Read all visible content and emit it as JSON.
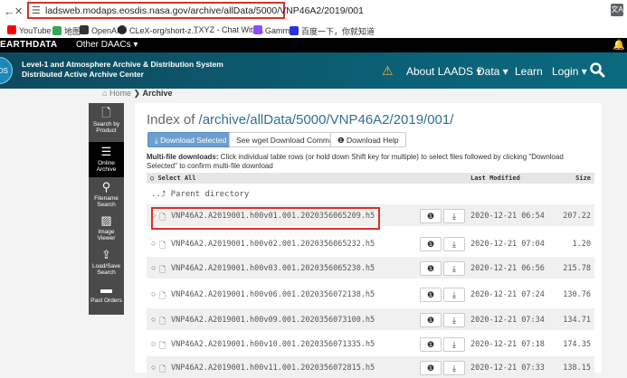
{
  "browser": {
    "back": "←",
    "close": "✕",
    "url": "ladsweb.modaps.eosdis.nasa.gov/archive/allData/5000/VNP46A2/2019/001",
    "translate_icon": "translate-icon"
  },
  "bookmarks": [
    {
      "label": "YouTube",
      "color": "#ff0000"
    },
    {
      "label": "地图",
      "color": "#34a853"
    },
    {
      "label": "OpenAI",
      "color": "#333333"
    },
    {
      "label": "CLeX-org/short-z...",
      "color": "#24292e"
    },
    {
      "label": "TXYZ - Chat With...",
      "color": "#ffffff"
    },
    {
      "label": "Gamma",
      "color": "#8a4dff"
    },
    {
      "label": "百度一下，你就知道",
      "color": "#2932e1"
    }
  ],
  "earthdata": {
    "logo": "EARTHDATA",
    "daacs": "Other DAACs ▾"
  },
  "header": {
    "logo_text": "ADS",
    "title_line1": "Level-1 and Atmosphere Archive & Distribution System",
    "title_line2": "Distributed Active Archive Center",
    "menu": {
      "about": "About LAADS ▾",
      "data": "Data ▾",
      "learn": "Learn",
      "login": "Login ▾"
    }
  },
  "breadcrumb": {
    "home": "Home",
    "current": "Archive"
  },
  "sidebar": [
    {
      "label": "Search by Product",
      "icon": "file-icon",
      "glyph": "🗋",
      "active": false
    },
    {
      "label": "Online Archive",
      "icon": "list-icon",
      "glyph": "☰",
      "active": true
    },
    {
      "label": "Filename Search",
      "icon": "search-icon",
      "glyph": "🔍",
      "active": false
    },
    {
      "label": "Image Viewer",
      "icon": "image-icon",
      "glyph": "▨",
      "active": false
    },
    {
      "label": "Load/Save Search",
      "icon": "upload-icon",
      "glyph": "⇪",
      "active": false
    },
    {
      "label": "Past Orders",
      "icon": "folder-icon",
      "glyph": "▬",
      "active": false
    }
  ],
  "main": {
    "index_prefix": "Index of ",
    "index_path": "/archive/allData/5000/VNP46A2/2019/001/",
    "buttons": {
      "download_selected": "Download Selected",
      "wget": "See wget Download Command",
      "help": "Download Help"
    },
    "multifile_bold": "Multi-file downloads:",
    "multifile_text": " Click individual table rows (or hold down Shift key for multiple) to select files followed by clicking \"Download Selected\" to confirm multi-file download",
    "table_header": {
      "select_all": "Select All",
      "last_modified": "Last Modified",
      "size": "Size"
    },
    "parent": "Parent directory",
    "files": [
      {
        "name": "VNP46A2.A2019001.h00v01.001.2020356065209.h5",
        "date": "2020-12-21 06:54",
        "size": "207.22"
      },
      {
        "name": "VNP46A2.A2019001.h00v02.001.2020356065232.h5",
        "date": "2020-12-21 07:04",
        "size": "1.20"
      },
      {
        "name": "VNP46A2.A2019001.h00v03.001.2020356065230.h5",
        "date": "2020-12-21 06:56",
        "size": "215.78"
      },
      {
        "name": "VNP46A2.A2019001.h00v06.001.2020356072138.h5",
        "date": "2020-12-21 07:24",
        "size": "130.76"
      },
      {
        "name": "VNP46A2.A2019001.h00v09.001.2020356073100.h5",
        "date": "2020-12-21 07:34",
        "size": "134.71"
      },
      {
        "name": "VNP46A2.A2019001.h00v10.001.2020356071335.h5",
        "date": "2020-12-21 07:18",
        "size": "174.35"
      },
      {
        "name": "VNP46A2.A2019001.h00v11.001.2020356072815.h5",
        "date": "2020-12-21 07:33",
        "size": "138.15"
      }
    ]
  }
}
